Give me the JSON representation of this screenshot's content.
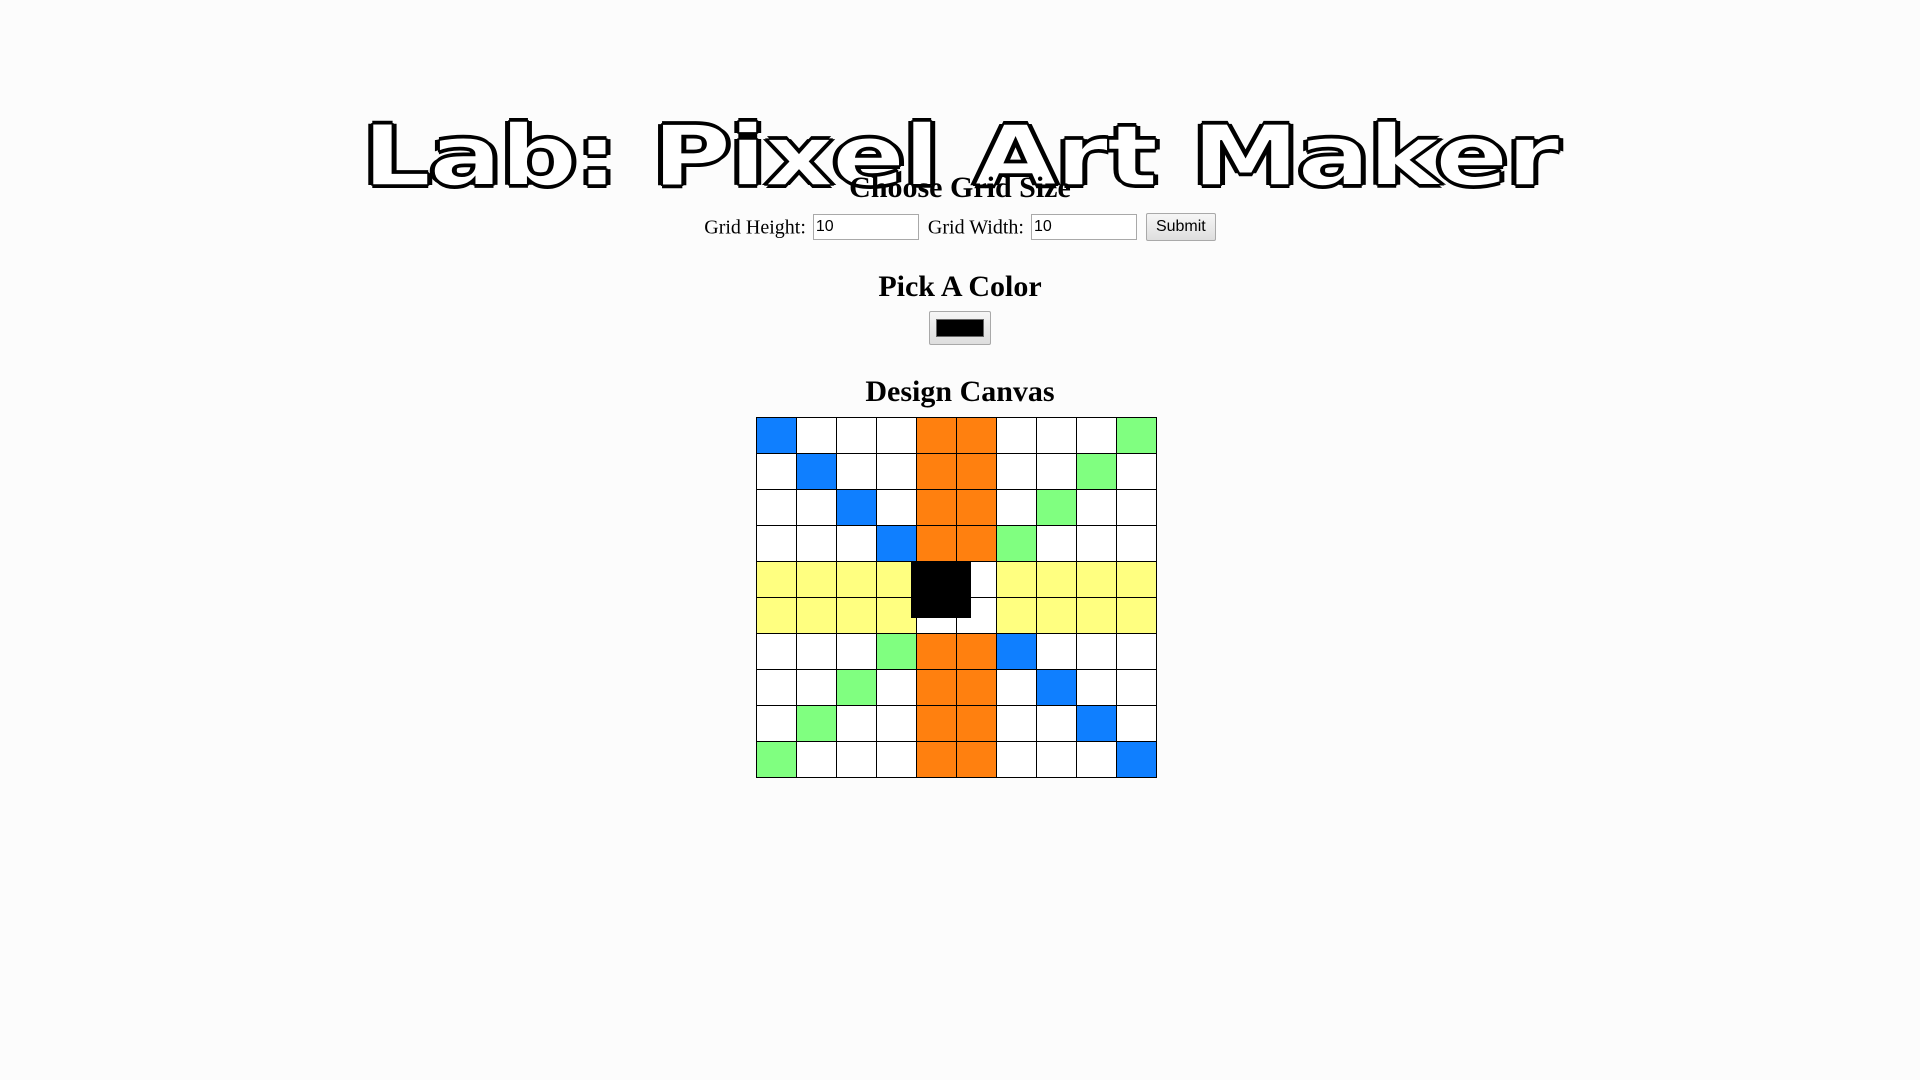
{
  "page": {
    "title": "Lab: Pixel Art Maker"
  },
  "grid_size": {
    "heading": "Choose Grid Size",
    "height_label": "Grid Height:",
    "height_value": "10",
    "width_label": "Grid Width:",
    "width_value": "10",
    "submit_label": "Submit"
  },
  "color_picker": {
    "heading": "Pick A Color",
    "selected_color": "#000000"
  },
  "canvas": {
    "heading": "Design Canvas",
    "palette": {
      "W": "#ffffff",
      "B": "#0f7fff",
      "G": "#80ff80",
      "O": "#ff800f",
      "Y": "#ffff80"
    },
    "rows": [
      [
        "B",
        "W",
        "W",
        "W",
        "O",
        "O",
        "W",
        "W",
        "W",
        "G"
      ],
      [
        "W",
        "B",
        "W",
        "W",
        "O",
        "O",
        "W",
        "W",
        "G",
        "W"
      ],
      [
        "W",
        "W",
        "B",
        "W",
        "O",
        "O",
        "W",
        "G",
        "W",
        "W"
      ],
      [
        "W",
        "W",
        "W",
        "B",
        "O",
        "O",
        "G",
        "W",
        "W",
        "W"
      ],
      [
        "Y",
        "Y",
        "Y",
        "Y",
        "W",
        "W",
        "Y",
        "Y",
        "Y",
        "Y"
      ],
      [
        "Y",
        "Y",
        "Y",
        "Y",
        "W",
        "W",
        "Y",
        "Y",
        "Y",
        "Y"
      ],
      [
        "W",
        "W",
        "W",
        "G",
        "O",
        "O",
        "B",
        "W",
        "W",
        "W"
      ],
      [
        "W",
        "W",
        "G",
        "W",
        "O",
        "O",
        "W",
        "B",
        "W",
        "W"
      ],
      [
        "W",
        "G",
        "W",
        "W",
        "O",
        "O",
        "W",
        "W",
        "B",
        "W"
      ],
      [
        "G",
        "W",
        "W",
        "W",
        "O",
        "O",
        "W",
        "W",
        "W",
        "B"
      ]
    ],
    "black_block_color": "#000000"
  }
}
